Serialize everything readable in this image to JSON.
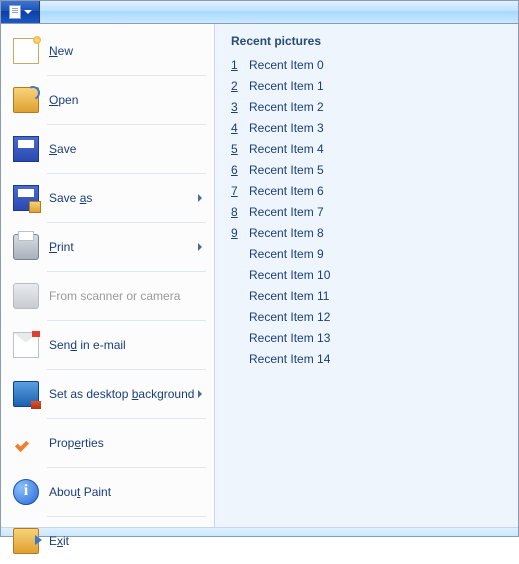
{
  "left_menu": {
    "new": "New",
    "open": "Open",
    "save": "Save",
    "save_as": "Save as",
    "print": "Print",
    "scanner": "From scanner or camera",
    "email": "Send in e-mail",
    "desktop_bg": "Set as desktop background",
    "properties": "Properties",
    "about": "About Paint",
    "exit": "Exit"
  },
  "right": {
    "heading": "Recent pictures",
    "items": [
      {
        "n": "1",
        "label": "Recent Item 0"
      },
      {
        "n": "2",
        "label": "Recent Item 1"
      },
      {
        "n": "3",
        "label": "Recent Item 2"
      },
      {
        "n": "4",
        "label": "Recent Item 3"
      },
      {
        "n": "5",
        "label": "Recent Item 4"
      },
      {
        "n": "6",
        "label": "Recent Item 5"
      },
      {
        "n": "7",
        "label": "Recent Item 6"
      },
      {
        "n": "8",
        "label": "Recent Item 7"
      },
      {
        "n": "9",
        "label": "Recent Item 8"
      },
      {
        "n": "",
        "label": "Recent Item 9"
      },
      {
        "n": "",
        "label": "Recent Item 10"
      },
      {
        "n": "",
        "label": "Recent Item 11"
      },
      {
        "n": "",
        "label": "Recent Item 12"
      },
      {
        "n": "",
        "label": "Recent Item 13"
      },
      {
        "n": "",
        "label": "Recent Item 14"
      }
    ]
  }
}
